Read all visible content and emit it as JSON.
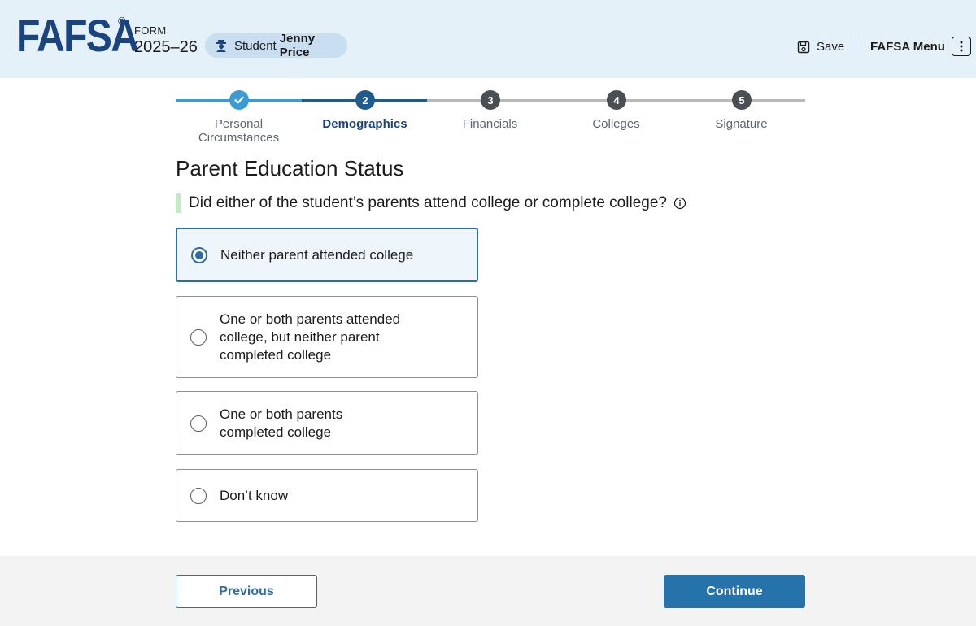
{
  "header": {
    "logo": "FAFSA",
    "registered_mark": "®",
    "form_label": "FORM",
    "form_year": "2025–26",
    "student_label": "Student",
    "student_name": "Jenny Price",
    "save_label": "Save",
    "menu_label": "FAFSA Menu",
    "icons": {
      "student": "graduation-cap-icon",
      "save": "save-disk-icon",
      "menu": "kebab-menu-icon"
    }
  },
  "stepper": {
    "steps": [
      {
        "number": "1",
        "label": "Personal Circumstances",
        "status": "complete"
      },
      {
        "number": "2",
        "label": "Demographics",
        "status": "current"
      },
      {
        "number": "3",
        "label": "Financials",
        "status": "upcoming"
      },
      {
        "number": "4",
        "label": "Colleges",
        "status": "upcoming"
      },
      {
        "number": "5",
        "label": "Signature",
        "status": "upcoming"
      }
    ]
  },
  "main": {
    "title": "Parent Education Status",
    "question": "Did either of the student’s parents attend college or complete college?",
    "options": [
      {
        "label": "Neither parent attended college",
        "selected": true
      },
      {
        "label": "One or both parents attended college, but neither parent completed college",
        "selected": false
      },
      {
        "label": "One or both parents completed college",
        "selected": false
      },
      {
        "label": "Don’t know",
        "selected": false
      }
    ]
  },
  "footer": {
    "previous_label": "Previous",
    "continue_label": "Continue"
  },
  "colors": {
    "header_bg": "#e5f1f9",
    "brand": "#1a4480",
    "primary": "#2673ac",
    "complete_step": "#3d9bd4",
    "current_step": "#1f5c8b",
    "upcoming_step": "#4a4f54",
    "footer_bg": "#f3f3f3"
  }
}
